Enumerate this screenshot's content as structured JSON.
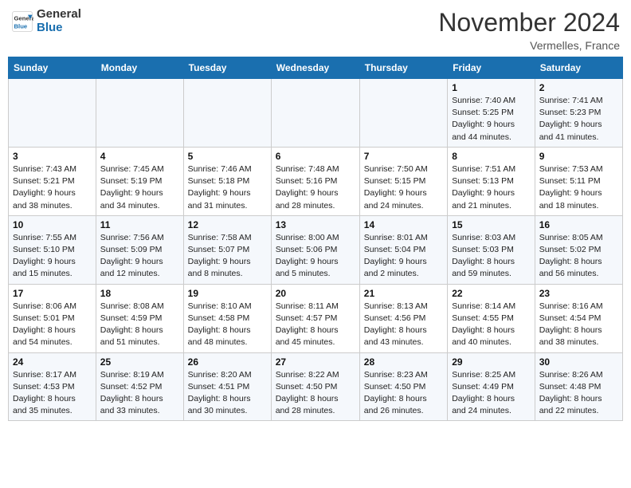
{
  "header": {
    "logo_line1": "General",
    "logo_line2": "Blue",
    "month": "November 2024",
    "location": "Vermelles, France"
  },
  "weekdays": [
    "Sunday",
    "Monday",
    "Tuesday",
    "Wednesday",
    "Thursday",
    "Friday",
    "Saturday"
  ],
  "weeks": [
    [
      {
        "day": "",
        "info": ""
      },
      {
        "day": "",
        "info": ""
      },
      {
        "day": "",
        "info": ""
      },
      {
        "day": "",
        "info": ""
      },
      {
        "day": "",
        "info": ""
      },
      {
        "day": "1",
        "info": "Sunrise: 7:40 AM\nSunset: 5:25 PM\nDaylight: 9 hours\nand 44 minutes."
      },
      {
        "day": "2",
        "info": "Sunrise: 7:41 AM\nSunset: 5:23 PM\nDaylight: 9 hours\nand 41 minutes."
      }
    ],
    [
      {
        "day": "3",
        "info": "Sunrise: 7:43 AM\nSunset: 5:21 PM\nDaylight: 9 hours\nand 38 minutes."
      },
      {
        "day": "4",
        "info": "Sunrise: 7:45 AM\nSunset: 5:19 PM\nDaylight: 9 hours\nand 34 minutes."
      },
      {
        "day": "5",
        "info": "Sunrise: 7:46 AM\nSunset: 5:18 PM\nDaylight: 9 hours\nand 31 minutes."
      },
      {
        "day": "6",
        "info": "Sunrise: 7:48 AM\nSunset: 5:16 PM\nDaylight: 9 hours\nand 28 minutes."
      },
      {
        "day": "7",
        "info": "Sunrise: 7:50 AM\nSunset: 5:15 PM\nDaylight: 9 hours\nand 24 minutes."
      },
      {
        "day": "8",
        "info": "Sunrise: 7:51 AM\nSunset: 5:13 PM\nDaylight: 9 hours\nand 21 minutes."
      },
      {
        "day": "9",
        "info": "Sunrise: 7:53 AM\nSunset: 5:11 PM\nDaylight: 9 hours\nand 18 minutes."
      }
    ],
    [
      {
        "day": "10",
        "info": "Sunrise: 7:55 AM\nSunset: 5:10 PM\nDaylight: 9 hours\nand 15 minutes."
      },
      {
        "day": "11",
        "info": "Sunrise: 7:56 AM\nSunset: 5:09 PM\nDaylight: 9 hours\nand 12 minutes."
      },
      {
        "day": "12",
        "info": "Sunrise: 7:58 AM\nSunset: 5:07 PM\nDaylight: 9 hours\nand 8 minutes."
      },
      {
        "day": "13",
        "info": "Sunrise: 8:00 AM\nSunset: 5:06 PM\nDaylight: 9 hours\nand 5 minutes."
      },
      {
        "day": "14",
        "info": "Sunrise: 8:01 AM\nSunset: 5:04 PM\nDaylight: 9 hours\nand 2 minutes."
      },
      {
        "day": "15",
        "info": "Sunrise: 8:03 AM\nSunset: 5:03 PM\nDaylight: 8 hours\nand 59 minutes."
      },
      {
        "day": "16",
        "info": "Sunrise: 8:05 AM\nSunset: 5:02 PM\nDaylight: 8 hours\nand 56 minutes."
      }
    ],
    [
      {
        "day": "17",
        "info": "Sunrise: 8:06 AM\nSunset: 5:01 PM\nDaylight: 8 hours\nand 54 minutes."
      },
      {
        "day": "18",
        "info": "Sunrise: 8:08 AM\nSunset: 4:59 PM\nDaylight: 8 hours\nand 51 minutes."
      },
      {
        "day": "19",
        "info": "Sunrise: 8:10 AM\nSunset: 4:58 PM\nDaylight: 8 hours\nand 48 minutes."
      },
      {
        "day": "20",
        "info": "Sunrise: 8:11 AM\nSunset: 4:57 PM\nDaylight: 8 hours\nand 45 minutes."
      },
      {
        "day": "21",
        "info": "Sunrise: 8:13 AM\nSunset: 4:56 PM\nDaylight: 8 hours\nand 43 minutes."
      },
      {
        "day": "22",
        "info": "Sunrise: 8:14 AM\nSunset: 4:55 PM\nDaylight: 8 hours\nand 40 minutes."
      },
      {
        "day": "23",
        "info": "Sunrise: 8:16 AM\nSunset: 4:54 PM\nDaylight: 8 hours\nand 38 minutes."
      }
    ],
    [
      {
        "day": "24",
        "info": "Sunrise: 8:17 AM\nSunset: 4:53 PM\nDaylight: 8 hours\nand 35 minutes."
      },
      {
        "day": "25",
        "info": "Sunrise: 8:19 AM\nSunset: 4:52 PM\nDaylight: 8 hours\nand 33 minutes."
      },
      {
        "day": "26",
        "info": "Sunrise: 8:20 AM\nSunset: 4:51 PM\nDaylight: 8 hours\nand 30 minutes."
      },
      {
        "day": "27",
        "info": "Sunrise: 8:22 AM\nSunset: 4:50 PM\nDaylight: 8 hours\nand 28 minutes."
      },
      {
        "day": "28",
        "info": "Sunrise: 8:23 AM\nSunset: 4:50 PM\nDaylight: 8 hours\nand 26 minutes."
      },
      {
        "day": "29",
        "info": "Sunrise: 8:25 AM\nSunset: 4:49 PM\nDaylight: 8 hours\nand 24 minutes."
      },
      {
        "day": "30",
        "info": "Sunrise: 8:26 AM\nSunset: 4:48 PM\nDaylight: 8 hours\nand 22 minutes."
      }
    ]
  ]
}
